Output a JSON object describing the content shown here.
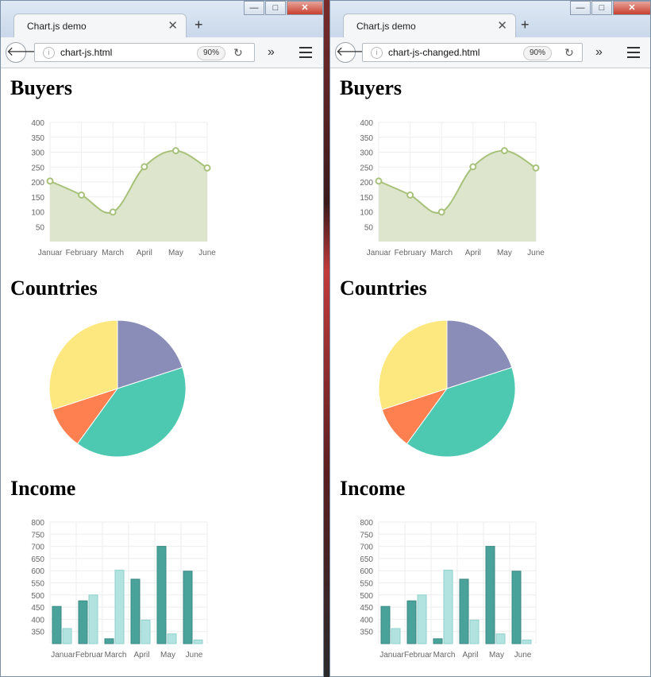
{
  "colors": {
    "line": "#a8c17a",
    "line_fill": "#dde6cc",
    "pie": [
      "#8a8db8",
      "#4cc9b0",
      "#fe8050",
      "#fde77f"
    ],
    "bar1": "#4aa39b",
    "bar2": "#b2e3e0"
  },
  "windows": [
    {
      "tab_title": "Chart.js demo",
      "url": "chart-js.html",
      "zoom": "90%"
    },
    {
      "tab_title": "Chart.js demo",
      "url": "chart-js-changed.html",
      "zoom": "90%"
    }
  ],
  "window_buttons": {
    "minimize": "—",
    "maximize": "□",
    "close": "✕"
  },
  "sections": {
    "buyers": "Buyers",
    "countries": "Countries",
    "income": "Income"
  },
  "chart_data": [
    {
      "type": "line",
      "title": "Buyers",
      "categories": [
        "January",
        "February",
        "March",
        "April",
        "May",
        "June"
      ],
      "tick_labels": [
        "Januar",
        "February",
        "March",
        "April",
        "May",
        "June"
      ],
      "values": [
        203,
        156,
        99,
        251,
        305,
        247
      ],
      "yticks": [
        50,
        100,
        150,
        200,
        250,
        300,
        350,
        400
      ],
      "ylim": [
        0,
        400
      ],
      "fill": true,
      "grid": true
    },
    {
      "type": "pie",
      "title": "Countries",
      "values": [
        20,
        40,
        10,
        30
      ],
      "colors": [
        "#8a8db8",
        "#4cc9b0",
        "#fe8050",
        "#fde77f"
      ]
    },
    {
      "type": "bar",
      "title": "Income",
      "categories": [
        "January",
        "February",
        "March",
        "April",
        "May",
        "June"
      ],
      "tick_labels": [
        "Januar",
        "Februar",
        "March",
        "April",
        "May",
        "June"
      ],
      "series": [
        {
          "values": [
            453,
            476,
            320,
            565,
            700,
            598
          ]
        },
        {
          "values": [
            362,
            500,
            602,
            397,
            340,
            315
          ]
        }
      ],
      "yticks": [
        350,
        400,
        450,
        500,
        550,
        600,
        650,
        700,
        750,
        800
      ],
      "ylim": [
        300,
        800
      ],
      "grid": true
    }
  ]
}
